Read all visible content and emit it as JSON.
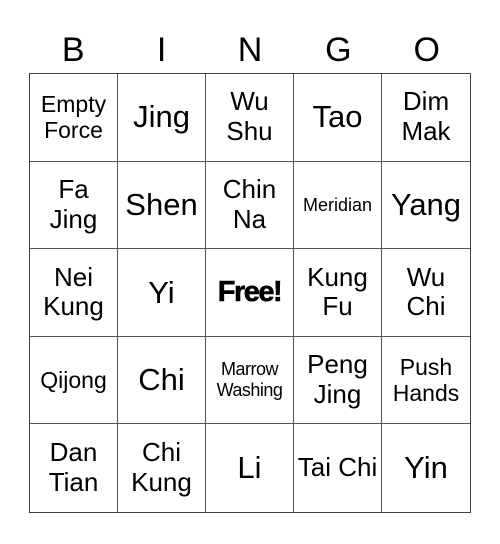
{
  "header": {
    "letters": [
      "B",
      "I",
      "N",
      "G",
      "O"
    ]
  },
  "cells": [
    {
      "label": "Empty Force",
      "size": "fs-s"
    },
    {
      "label": "Jing",
      "size": "fs-l"
    },
    {
      "label": "Wu Shu",
      "size": "fs-m"
    },
    {
      "label": "Tao",
      "size": "fs-l"
    },
    {
      "label": "Dim Mak",
      "size": "fs-m"
    },
    {
      "label": "Fa Jing",
      "size": "fs-m"
    },
    {
      "label": "Shen",
      "size": "fs-l"
    },
    {
      "label": "Chin Na",
      "size": "fs-m"
    },
    {
      "label": "Meridian",
      "size": "fs-xs"
    },
    {
      "label": "Yang",
      "size": "fs-l"
    },
    {
      "label": "Nei Kung",
      "size": "fs-m"
    },
    {
      "label": "Yi",
      "size": "fs-l"
    },
    {
      "label": "Free!",
      "size": "free"
    },
    {
      "label": "Kung Fu",
      "size": "fs-m"
    },
    {
      "label": "Wu Chi",
      "size": "fs-m"
    },
    {
      "label": "Qijong",
      "size": "fs-s"
    },
    {
      "label": "Chi",
      "size": "fs-l"
    },
    {
      "label": "Marrow Washing",
      "size": "fs-xxs"
    },
    {
      "label": "Peng Jing",
      "size": "fs-m"
    },
    {
      "label": "Push Hands",
      "size": "fs-s"
    },
    {
      "label": "Dan Tian",
      "size": "fs-m"
    },
    {
      "label": "Chi Kung",
      "size": "fs-m"
    },
    {
      "label": "Li",
      "size": "fs-l"
    },
    {
      "label": "Tai Chi",
      "size": "fs-m"
    },
    {
      "label": "Yin",
      "size": "fs-l"
    }
  ]
}
